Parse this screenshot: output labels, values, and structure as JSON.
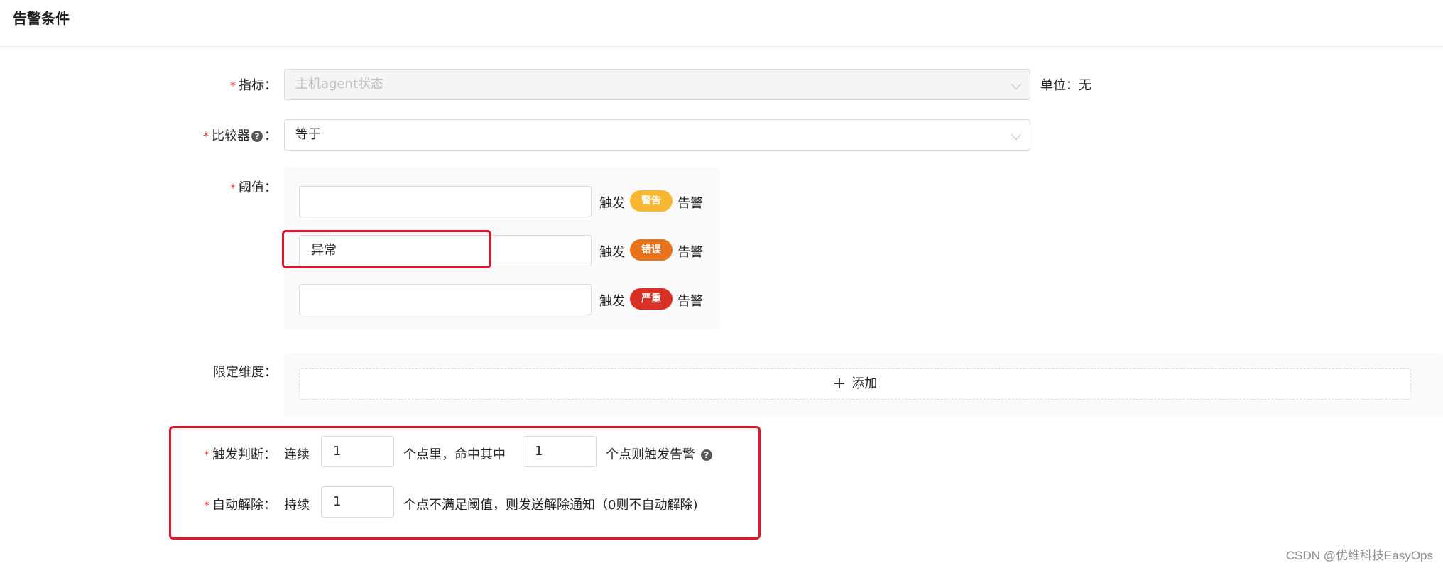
{
  "header": {
    "title": "告警条件"
  },
  "metric": {
    "label": "指标：",
    "value": "主机agent状态",
    "unit_label": "单位：无"
  },
  "comparator": {
    "label": "比较器",
    "colon": "：",
    "value": "等于"
  },
  "threshold": {
    "label": "阈值：",
    "rows": [
      {
        "value": "",
        "trigger": "触发",
        "badge": "警告",
        "badge_color": "#f7b731",
        "suffix": "告警"
      },
      {
        "value": "异常",
        "trigger": "触发",
        "badge": "错误",
        "badge_color": "#e8731b",
        "suffix": "告警"
      },
      {
        "value": "",
        "trigger": "触发",
        "badge": "严重",
        "badge_color": "#d93025",
        "suffix": "告警"
      }
    ]
  },
  "dimension": {
    "label": "限定维度：",
    "add_label": "添加"
  },
  "trigger_judge": {
    "label": "触发判断：",
    "prefix": "连续",
    "count_value": "1",
    "middle": "个点里，命中其中",
    "hit_value": "1",
    "suffix": "个点则触发告警"
  },
  "auto_resolve": {
    "label": "自动解除：",
    "prefix": "持续",
    "value": "1",
    "suffix": "个点不满足阈值，则发送解除通知（0则不自动解除)"
  },
  "watermark": "CSDN @优维科技EasyOps",
  "colors": {
    "required": "#e4393c",
    "highlight_box": "#e8132b"
  }
}
